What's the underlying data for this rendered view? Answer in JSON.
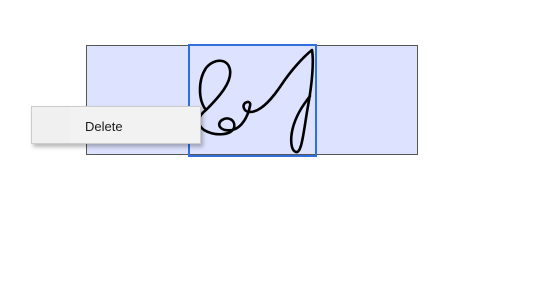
{
  "signature_field": {
    "background_color": "#dde2ff",
    "selection_color": "#2f6fde",
    "ink_color": "#000000",
    "content_icon": "handwritten-signature"
  },
  "context_menu": {
    "items": [
      {
        "label": "Delete",
        "icon": ""
      }
    ]
  }
}
